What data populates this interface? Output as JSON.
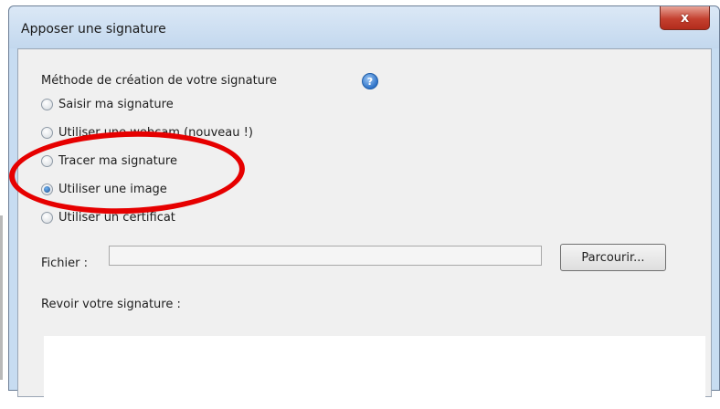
{
  "dialog": {
    "title": "Apposer une signature",
    "close_label": "x"
  },
  "method": {
    "heading": "Méthode de création de votre signature",
    "help_icon": "question-help-icon",
    "options": [
      {
        "label": "Saisir ma signature",
        "selected": false
      },
      {
        "label": "Utiliser une webcam (nouveau !)",
        "selected": false
      },
      {
        "label": "Tracer ma signature",
        "selected": false
      },
      {
        "label": "Utiliser une image",
        "selected": true
      },
      {
        "label": "Utiliser un certificat",
        "selected": false
      }
    ]
  },
  "file": {
    "label": "Fichier :",
    "value": "",
    "browse_label": "Parcourir..."
  },
  "review": {
    "label": "Revoir votre signature :"
  },
  "colors": {
    "annotation": "#e60000",
    "titlebar": "#c7dcf1",
    "close_button": "#c4402f"
  }
}
